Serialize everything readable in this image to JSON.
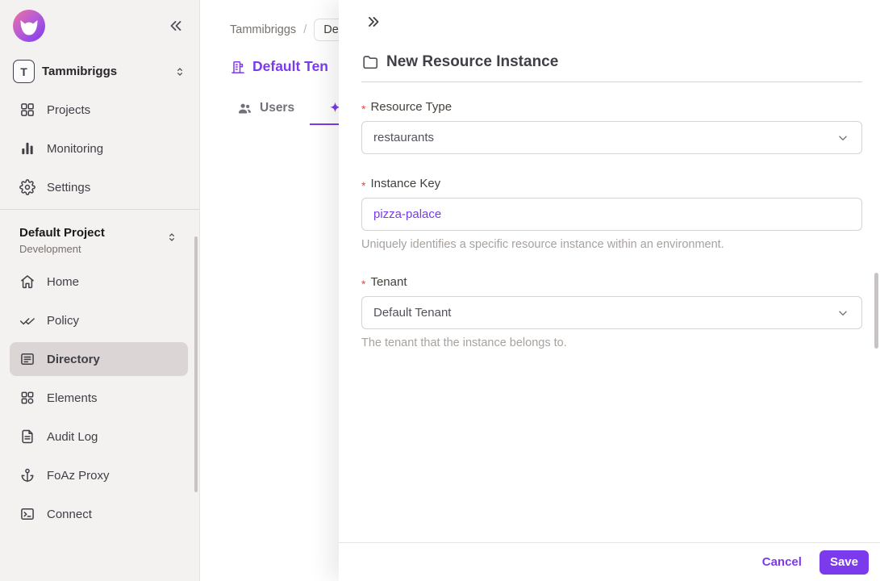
{
  "colors": {
    "accent": "#7c3aed",
    "sidebar_bg": "#f4f1f1",
    "active_item_bg": "#dcd5d5",
    "required_marker": "#ef4444",
    "helper_text": "#a8a29e",
    "save_button_bg": "#7c3aed"
  },
  "icons": [
    "permit-logo",
    "double-chevron-left",
    "chevron-up-down",
    "grid",
    "bar-chart",
    "gear",
    "home",
    "double-check",
    "directory-list",
    "elements-grid",
    "document",
    "anchor",
    "terminal",
    "users",
    "sparkle",
    "building",
    "double-chevron-right",
    "folder",
    "chevron-down"
  ],
  "sidebar": {
    "org": {
      "initial": "T",
      "name": "Tammibriggs"
    },
    "top_items": [
      {
        "label": "Projects"
      },
      {
        "label": "Monitoring"
      },
      {
        "label": "Settings"
      }
    ],
    "project": {
      "name": "Default Project",
      "environment": "Development"
    },
    "nav_items": [
      {
        "label": "Home"
      },
      {
        "label": "Policy"
      },
      {
        "label": "Directory",
        "active": true
      },
      {
        "label": "Elements"
      },
      {
        "label": "Audit Log"
      },
      {
        "label": "FoAz Proxy"
      },
      {
        "label": "Connect"
      }
    ]
  },
  "content": {
    "breadcrumb": {
      "root": "Tammibriggs",
      "separator": "/",
      "current_fragment": "De"
    },
    "page_title_fragment": "Default Ten",
    "tabs": {
      "users_label": "Users"
    }
  },
  "drawer": {
    "title": "New Resource Instance",
    "required_marker": "*",
    "resource_type": {
      "label": "Resource Type",
      "value": "restaurants"
    },
    "instance_key": {
      "label": "Instance Key",
      "value": "pizza-palace",
      "helper": "Uniquely identifies a specific resource instance within an environment."
    },
    "tenant": {
      "label": "Tenant",
      "value": "Default Tenant",
      "helper": "The tenant that the instance belongs to."
    },
    "footer": {
      "cancel_label": "Cancel",
      "save_label": "Save"
    }
  }
}
